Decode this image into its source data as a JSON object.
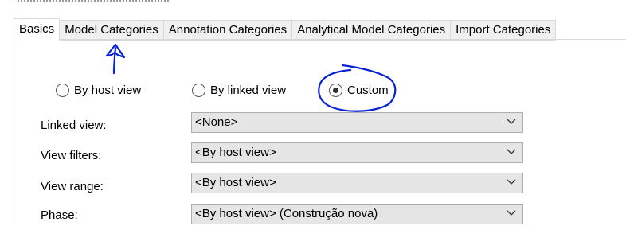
{
  "tabs": [
    {
      "label": "Basics",
      "active": true
    },
    {
      "label": "Model Categories",
      "active": false
    },
    {
      "label": "Annotation Categories",
      "active": false
    },
    {
      "label": "Analytical Model Categories",
      "active": false
    },
    {
      "label": "Import Categories",
      "active": false
    }
  ],
  "visibility_mode": {
    "options": [
      {
        "label": "By host view",
        "selected": false
      },
      {
        "label": "By linked view",
        "selected": false
      },
      {
        "label": "Custom",
        "selected": true
      }
    ]
  },
  "fields": [
    {
      "label": "Linked view:",
      "value": "<None>"
    },
    {
      "label": "View filters:",
      "value": "<By host view>"
    },
    {
      "label": "View range:",
      "value": "<By host view>"
    },
    {
      "label": "Phase:",
      "value": "<By host view> (Construção nova)"
    }
  ],
  "annotations": {
    "ink_color": "#0a22d6",
    "marks": [
      "arrow pointing up at Model Categories tab",
      "circle around Custom option"
    ]
  },
  "icons": {
    "dropdown": "chevron-down-icon"
  }
}
